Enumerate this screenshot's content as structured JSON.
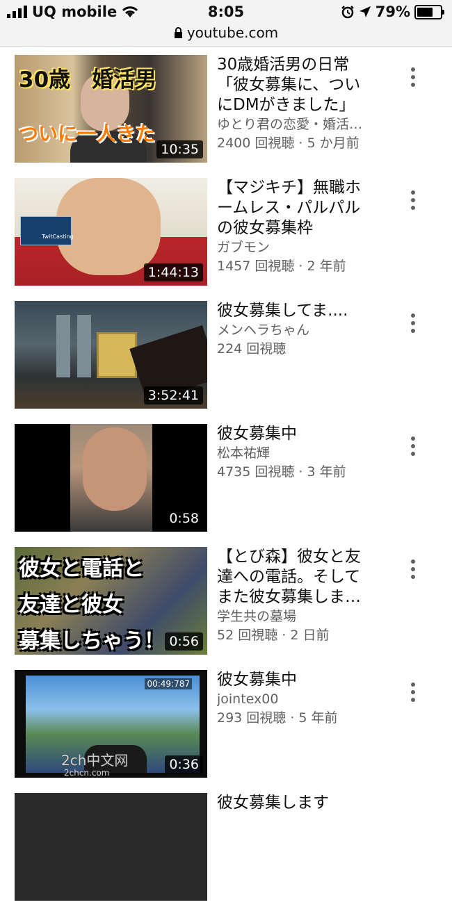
{
  "status_bar": {
    "carrier": "UQ mobile",
    "time": "8:05",
    "battery_percent": "79%",
    "battery_level": 0.79,
    "url": "youtube.com"
  },
  "videos": [
    {
      "title": "30歳婚活男の日常「彼女募集に、ついにDMがきました」",
      "channel": "ゆとり君の恋愛・婚活…",
      "stats": "2400 回視聴 · 5 か月前",
      "duration": "10:35",
      "thumb_text_1": "30歳　婚活男",
      "thumb_text_2": "ついに一人きた"
    },
    {
      "title": "【マジキチ】無職ホームレス・パルパルの彼女募集枠",
      "channel": "ガブモン",
      "stats": "1457 回視聴 · 2 年前",
      "duration": "1:44:13",
      "thumb_text_1": "TwitCasting"
    },
    {
      "title": "彼女募集してま....",
      "channel": "メンヘラちゃん",
      "stats": "224 回視聴",
      "duration": "3:52:41"
    },
    {
      "title": "彼女募集中",
      "channel": "松本祐輝",
      "stats": "4735 回視聴 · 3 年前",
      "duration": "0:58"
    },
    {
      "title": "【とび森】彼女と友達への電話。そしてまた彼女募集しま…",
      "channel": "学生共の墓場",
      "stats": "52 回視聴 · 2 日前",
      "duration": "0:56",
      "thumb_text_1": "彼女と電話と",
      "thumb_text_2": "友達と彼女",
      "thumb_text_3": "募集しちゃう！"
    },
    {
      "title": "彼女募集中",
      "channel": "jointex00",
      "stats": "293 回視聴 · 5 年前",
      "duration": "0:36",
      "thumb_text_1": "00:49:787"
    },
    {
      "title": "彼女募集します"
    }
  ],
  "watermark": {
    "main": "2ch中文网",
    "sub": "2chcn.com"
  }
}
